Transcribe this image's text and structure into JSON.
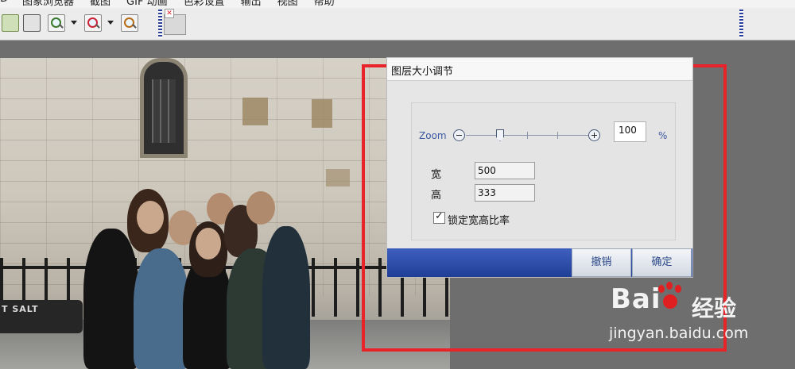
{
  "menubar": {
    "items": [
      "D",
      "图象浏览器",
      "截图",
      "GIF 动画",
      "色彩设置",
      "输出",
      "视图",
      "帮助"
    ]
  },
  "toolbar": {
    "icons": [
      "paste-icon",
      "paste-special-icon",
      "zoom-in-icon",
      "zoom-out-icon",
      "zoom-fit-icon",
      "broken-image-icon"
    ]
  },
  "photo": {
    "sign_text": "T SALT"
  },
  "dialog": {
    "title": "图层大小调节",
    "zoom_label": "Zoom",
    "zoom_value": "100",
    "percent_label": "%",
    "zoom_level_percent": 100,
    "width_label": "宽",
    "width_value": "500",
    "height_label": "高",
    "height_value": "333",
    "lock_ratio_label": "锁定宽高比率",
    "lock_ratio_checked": true,
    "cancel_label": "撤销",
    "ok_label": "确定"
  },
  "watermark": {
    "logo_text": "Bai",
    "logo_suffix": "经验",
    "url": "jingyan.baidu.com"
  },
  "colors": {
    "highlight": "#e8232a",
    "dialog_footer": "#1f3f95",
    "zoom_accent": "#3b5aa3"
  }
}
